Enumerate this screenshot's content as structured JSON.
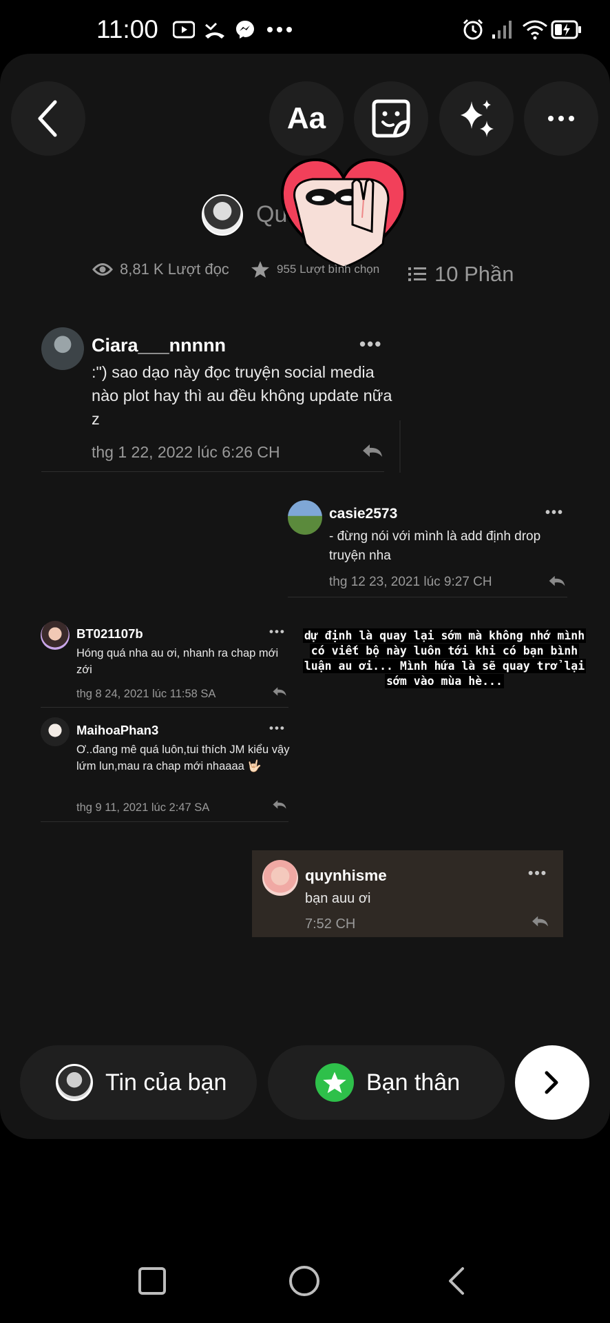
{
  "status_bar": {
    "time": "11:00",
    "icons": [
      "youtube-icon",
      "missed-call-icon",
      "messenger-icon",
      "more-notifications-icon",
      "alarm-icon",
      "signal-icon",
      "wifi-icon",
      "battery-charging-icon"
    ]
  },
  "toolbar": {
    "back_icon": "chevron-left-icon",
    "text_label": "Aa",
    "sticker_icon": "sticker-icon",
    "effects_icon": "sparkles-icon",
    "more_icon": "more-icon"
  },
  "story": {
    "title": "Qu",
    "views": "8,81 K Lượt đọc",
    "votes": "955 Lượt bình chọn",
    "parts": "10 Phần"
  },
  "comments": [
    {
      "user": "Ciara___nnnnn",
      "text": ":\") sao dạo này đọc truyện social media nào plot hay thì au đều không update nữa z",
      "date": "thg 1 22, 2022 lúc 6:26 CH"
    },
    {
      "user": "casie2573",
      "text": "- đừng nói với mình là add định drop truyện nha",
      "date": "thg 12 23, 2021 lúc 9:27 CH"
    },
    {
      "user": "BT021107b",
      "text": "Hóng quá nha au ơi, nhanh ra chap mới zới",
      "date": "thg 8 24, 2021 lúc 11:58 SA"
    },
    {
      "user": "MaihoaPhan3",
      "text": "Ơ..đang mê quá luôn,tui thích JM kiểu vậy lứm lun,mau ra chap mới nhaaaa 🤟🏻",
      "date": "thg 9 11, 2021 lúc 2:47 SA"
    },
    {
      "user": "quynhisme",
      "text": "bạn auu ơi",
      "date": "7:52 CH"
    }
  ],
  "author_note": "dự định là quay lại sớm mà không nhớ mình có viết bộ này luôn tới khi có bạn bình luận au ơi... Mình hứa là sẽ quay trở lại sớm vào mùa hè...",
  "share_bar": {
    "your_story": "Tin của bạn",
    "close_friends": "Bạn thân",
    "send_icon": "chevron-right-icon"
  },
  "nav_bar": {
    "icons": [
      "recents-icon",
      "home-icon",
      "back-icon"
    ]
  },
  "colors": {
    "sheet_bg": "#141414",
    "button_bg": "#1f1f1f",
    "heart_red": "#f2405a",
    "close_friends_green": "#2ec04a",
    "highlight_card": "#2f2924"
  }
}
